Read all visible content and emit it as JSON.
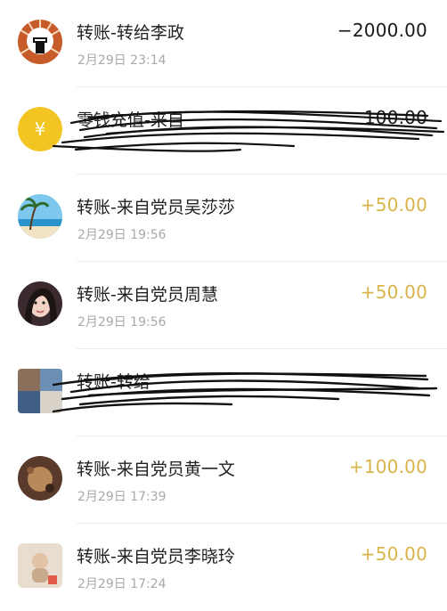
{
  "colors": {
    "income": "#d9b44a",
    "expense": "#1a1a1a",
    "coin": "#f2c523",
    "scribble": "#111111"
  },
  "transactions": [
    {
      "avatar_icon": "raised-fist-icon",
      "title": "转账-转给李政",
      "time": "2月29日 23:14",
      "amount": "−2000.00",
      "type": "expense",
      "redacted": false
    },
    {
      "avatar_icon": "coin-yuan-icon",
      "title": "零钱充值-来自",
      "time": "",
      "amount": "100.00",
      "type": "expense",
      "redacted": true
    },
    {
      "avatar_icon": "beach-photo-icon",
      "title": "转账-来自党员吴莎莎",
      "time": "2月29日 19:56",
      "amount": "+50.00",
      "type": "income",
      "redacted": false
    },
    {
      "avatar_icon": "girl-photo-icon",
      "title": "转账-来自党员周慧",
      "time": "2月29日 19:56",
      "amount": "+50.00",
      "type": "income",
      "redacted": false
    },
    {
      "avatar_icon": "photo-collage-icon",
      "title": "转账-转给",
      "time": "",
      "amount": "",
      "type": "expense",
      "redacted": true
    },
    {
      "avatar_icon": "figurine-photo-icon",
      "title": "转账-来自党员黄一文",
      "time": "2月29日 17:39",
      "amount": "+100.00",
      "type": "income",
      "redacted": false
    },
    {
      "avatar_icon": "toy-photo-icon",
      "title": "转账-来自党员李晓玲",
      "time": "2月29日 17:24",
      "amount": "+50.00",
      "type": "income",
      "redacted": false
    }
  ]
}
